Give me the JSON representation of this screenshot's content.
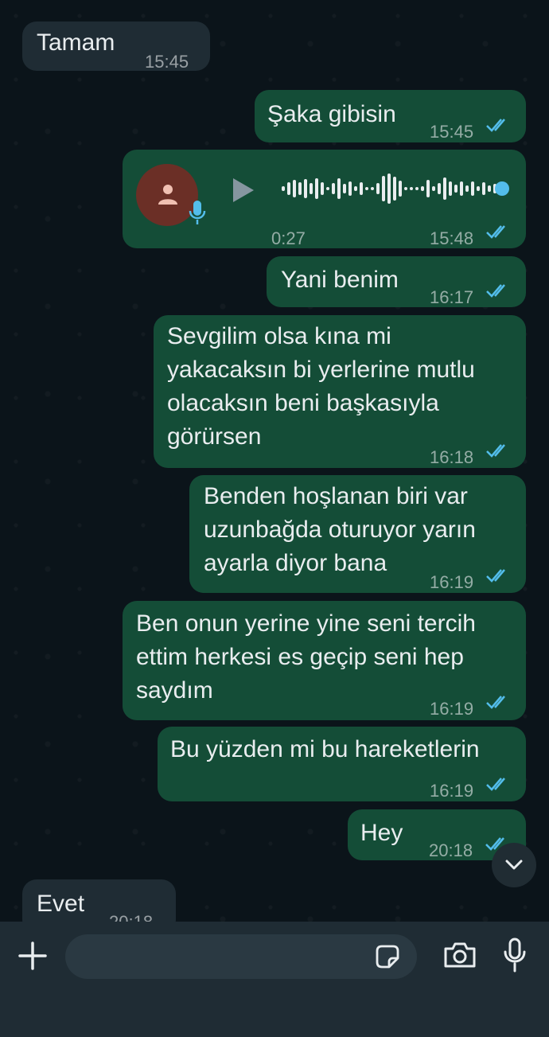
{
  "messages": [
    {
      "text": "Tamam",
      "time": "15:45",
      "direction": "in"
    },
    {
      "text": "Şaka gibisin",
      "time": "15:45",
      "direction": "out"
    },
    {
      "type": "voice",
      "duration": "0:27",
      "time": "15:48",
      "direction": "out"
    },
    {
      "text": "Yani benim",
      "time": "16:17",
      "direction": "out"
    },
    {
      "text": "Sevgilim olsa kına mi yakacaksın bi yerlerine mutlu olacaksın beni başkasıyla görürsen",
      "time": "16:18",
      "direction": "out"
    },
    {
      "text": "Benden hoşlanan biri var uzunbağda oturuyor yarın ayarla diyor bana",
      "time": "16:19",
      "direction": "out"
    },
    {
      "text": "Ben onun yerine yine seni tercih ettim herkesi es geçip seni hep saydım",
      "time": "16:19",
      "direction": "out"
    },
    {
      "text": "Bu yüzden mi bu hareketlerin",
      "time": "16:19",
      "direction": "out"
    },
    {
      "text": "Hey",
      "time": "20:18",
      "direction": "out"
    },
    {
      "text": "Evet",
      "time": "20:18",
      "direction": "in"
    }
  ],
  "colors": {
    "outgoing_bubble": "#144d37",
    "incoming_bubble": "#1f2c34",
    "read_ticks": "#53bdeb",
    "background": "#0b141a"
  },
  "icons": [
    "plus-icon",
    "sticker-icon",
    "camera-icon",
    "microphone-icon",
    "chevron-down-icon",
    "play-icon",
    "avatar-icon",
    "mic-badge-icon",
    "double-check-icon"
  ]
}
